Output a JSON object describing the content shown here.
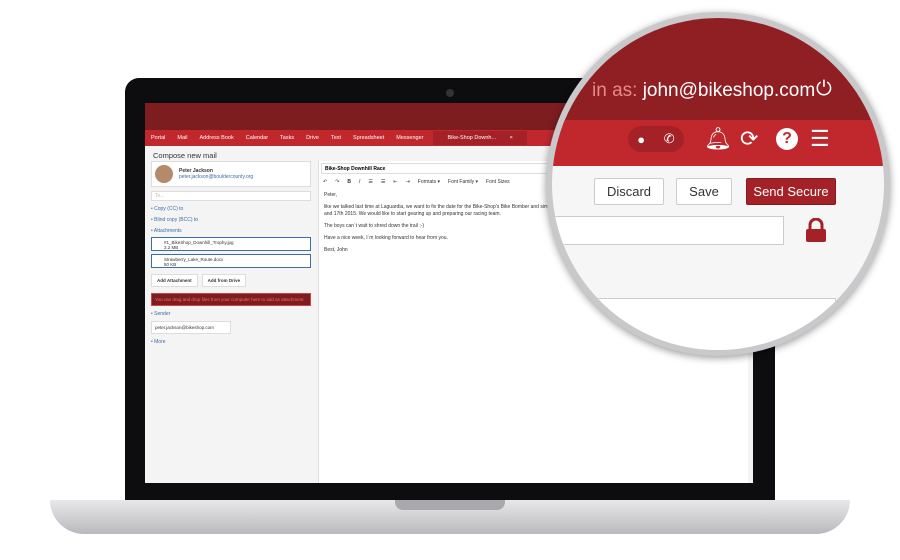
{
  "nav": [
    "Portal",
    "Mail",
    "Address Book",
    "Calendar",
    "Tasks",
    "Drive",
    "Text",
    "Spreadsheet",
    "Messenger"
  ],
  "active_tab": "Bike-Shop Downh...",
  "close_tab": "×",
  "compose_title": "Compose new mail",
  "from": {
    "name": "Peter Jackson",
    "email": "peter.jackson@bouldercounty.org"
  },
  "to_placeholder": "To...",
  "links": {
    "cc": "• Copy (CC) to",
    "bcc": "• Blind copy (BCC) to",
    "attachments": "• Attachments",
    "sender": "• Sender",
    "more": "• More"
  },
  "attachments": [
    {
      "name": "#1_BikeShop_Downhill_Trophy.jpg",
      "size": "3.2 MB"
    },
    {
      "name": "Strawberry_Lake_Route.docx",
      "size": "50 KB"
    }
  ],
  "add_attachment": "Add Attachment",
  "add_from_drive": "Add from Drive",
  "drop_hint": "You can drag and drop files from your computer here to add as attachment.",
  "sender_value": "peter.jackson@bikeshop.com",
  "subject": "Bike-Shop Downhill Race",
  "toolbar": {
    "formats": "Formats ▾",
    "font_family": "Font Family ▾",
    "font_sizes": "Font Sizes"
  },
  "body": [
    "Peter,",
    "like we talked last time at Laguardia, we want to fix the date for the Bike-Shop's Bike Bomber and simply gorgeous mountains of yours. Would you please be so kind and confirm our rese and 17th 2015. We would like to start gearing up and preparing our racing team.",
    "The boys can´t wait to shred down the trail ;-)",
    "Have a nice week, I´m looking forward to hear from you.",
    "Best, John"
  ],
  "zoom": {
    "login_prefix": "in as:",
    "login_email": "john@bikeshop.com",
    "discard": "Discard",
    "save": "Save",
    "send_secure": "Send Secure"
  },
  "colors": {
    "brand_red": "#c0282d",
    "dark_red": "#7d1d20"
  }
}
